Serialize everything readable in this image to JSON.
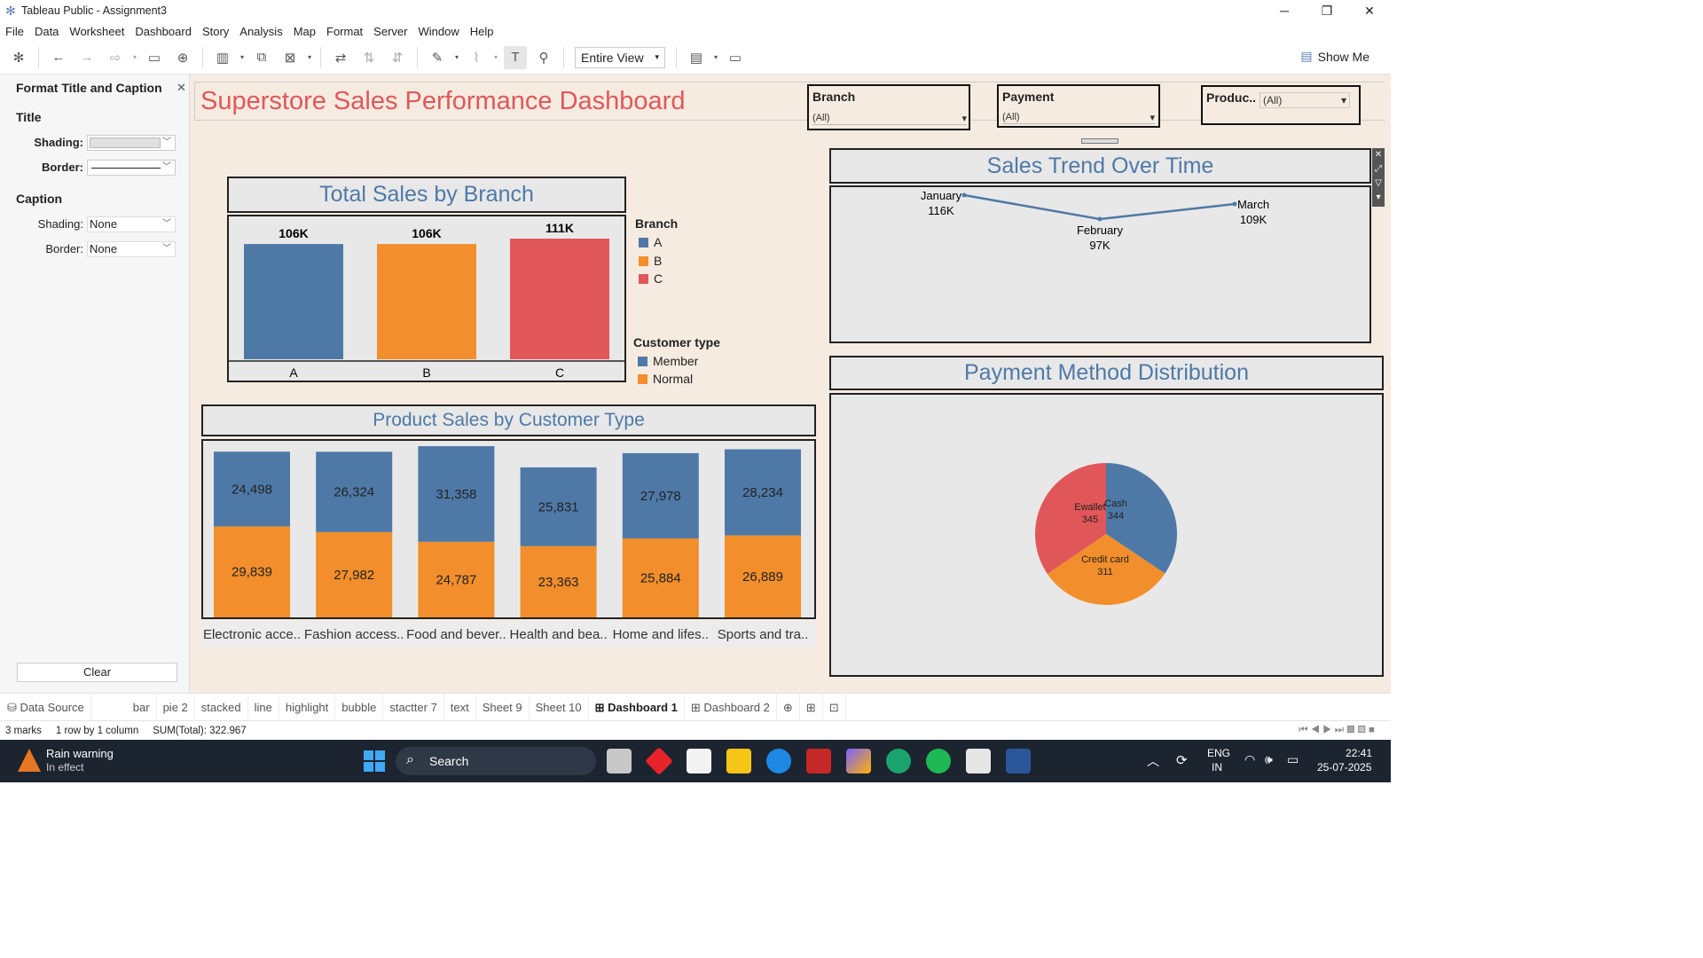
{
  "window": {
    "title": "Tableau Public - Assignment3"
  },
  "menu": [
    "File",
    "Data",
    "Worksheet",
    "Dashboard",
    "Story",
    "Analysis",
    "Map",
    "Format",
    "Server",
    "Window",
    "Help"
  ],
  "toolbar": {
    "fit": "Entire View",
    "show_me": "Show Me"
  },
  "format_panel": {
    "header": "Format Title and Caption",
    "title_section": "Title",
    "shading_label": "Shading:",
    "border_label": "Border:",
    "caption_section": "Caption",
    "caption_shading_label": "Shading:",
    "caption_shading_value": "None",
    "caption_border_label": "Border:",
    "caption_border_value": "None",
    "clear": "Clear"
  },
  "dashboard": {
    "title": "Superstore Sales Performance Dashboard",
    "filters": [
      {
        "label": "Branch",
        "value": "(All)"
      },
      {
        "label": "Payment",
        "value": "(All)"
      },
      {
        "label": "Produc..",
        "value": "(All)"
      }
    ],
    "branch_chart": {
      "title": "Total Sales by Branch",
      "legend_branch_title": "Branch",
      "legend_customer_title": "Customer type",
      "legend_customer": [
        "Member",
        "Normal"
      ]
    },
    "trend_chart": {
      "title": "Sales Trend Over Time"
    },
    "product_chart": {
      "title": "Product Sales by Customer Type"
    },
    "payment_chart": {
      "title": "Payment Method Distribution"
    }
  },
  "chart_data": [
    {
      "type": "bar",
      "title": "Total Sales by Branch",
      "categories": [
        "A",
        "B",
        "C"
      ],
      "values": [
        106,
        106,
        111
      ],
      "value_labels": [
        "106K",
        "106K",
        "111K"
      ],
      "colors": [
        "#4e79a7",
        "#f28e2b",
        "#e15759"
      ],
      "legend": [
        "A",
        "B",
        "C"
      ]
    },
    {
      "type": "line",
      "title": "Sales Trend Over Time",
      "categories": [
        "January",
        "February",
        "March"
      ],
      "values": [
        116,
        97,
        109
      ],
      "value_labels": [
        "116K",
        "97K",
        "109K"
      ]
    },
    {
      "type": "bar",
      "title": "Product Sales by Customer Type",
      "categories": [
        "Electronic acce..",
        "Fashion access..",
        "Food and bever..",
        "Health and bea..",
        "Home and lifes..",
        "Sports and tra.."
      ],
      "series": [
        {
          "name": "Member",
          "values": [
            24498,
            26324,
            31358,
            25831,
            27978,
            28234
          ],
          "labels": [
            "24,498",
            "26,324",
            "31,358",
            "25,831",
            "27,978",
            "28,234"
          ],
          "color": "#4e79a7"
        },
        {
          "name": "Normal",
          "values": [
            29839,
            27982,
            24787,
            23363,
            25884,
            26889
          ],
          "labels": [
            "29,839",
            "27,982",
            "24,787",
            "23,363",
            "25,884",
            "26,889"
          ],
          "color": "#f28e2b"
        }
      ]
    },
    {
      "type": "pie",
      "title": "Payment Method Distribution",
      "slices": [
        {
          "label": "Cash",
          "value": 344,
          "color": "#4e79a7"
        },
        {
          "label": "Credit card",
          "value": 311,
          "color": "#f28e2b"
        },
        {
          "label": "Ewallet",
          "value": 345,
          "color": "#e15759"
        }
      ]
    }
  ],
  "tabs": [
    "Data Source",
    "bar",
    "pie 2",
    "stacked",
    "line",
    "highlight",
    "bubble",
    "stactter 7",
    "text",
    "Sheet 9",
    "Sheet 10",
    "Dashboard 1",
    "Dashboard 2"
  ],
  "active_tab": "Dashboard 1",
  "status": {
    "marks": "3 marks",
    "layout": "1 row by 1 column",
    "sum": "SUM(Total): 322.967"
  },
  "taskbar": {
    "weather_title": "Rain warning",
    "weather_sub": "In effect",
    "search": "Search",
    "lang1": "ENG",
    "lang2": "IN",
    "time": "22:41",
    "date": "25-07-2025"
  }
}
